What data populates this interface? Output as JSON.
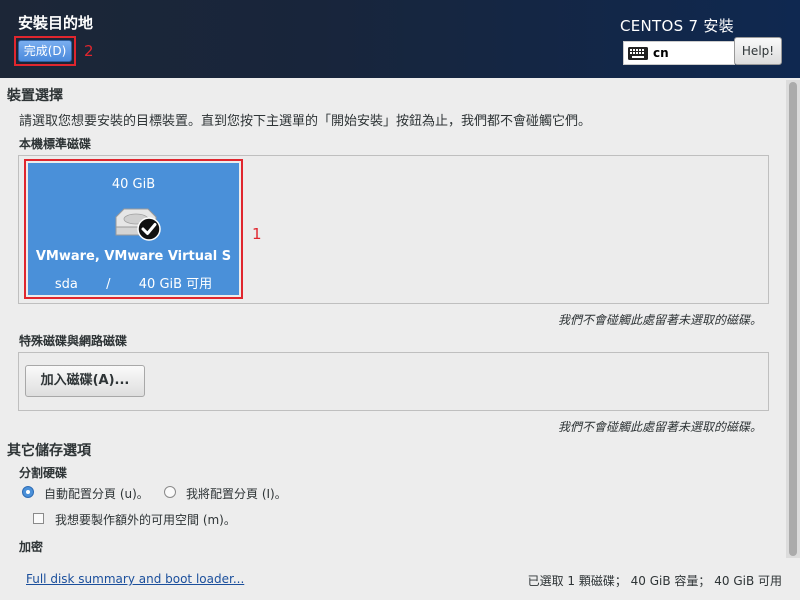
{
  "header": {
    "title": "安裝目的地",
    "done_label": "完成(D)",
    "annotation_done": "2",
    "product_title": "CENTOS 7 安裝",
    "keyboard_layout": "cn",
    "help_label": "Help!"
  },
  "device_selection": {
    "heading": "裝置選擇",
    "description": "請選取您想要安裝的目標裝置。直到您按下主選單的「開始安裝」按鈕為止，我們都不會碰觸它們。",
    "local_disks_heading": "本機標準磁碟",
    "disk": {
      "size": "40 GiB",
      "name": "VMware, VMware Virtual S",
      "device": "sda",
      "separator": "/",
      "free": "40 GiB 可用"
    },
    "annotation_disk": "1",
    "local_note": "我們不會碰觸此處留著未選取的磁碟。",
    "special_heading": "特殊磁碟與網路磁碟",
    "add_disk_label": "加入磁碟(A)...",
    "special_note": "我們不會碰觸此處留著未選取的磁碟。"
  },
  "other_storage": {
    "heading": "其它儲存選項",
    "partitioning_heading": "分割硬碟",
    "auto_partition_label": "自動配置分頁 (u)。",
    "manual_partition_label": "我將配置分頁 (I)。",
    "extra_space_label": "我想要製作額外的可用空間 (m)。",
    "encryption_heading": "加密"
  },
  "footer": {
    "summary_link": "Full disk summary and boot loader...",
    "status": "已選取 1 顆磁碟； 40 GiB 容量； 40 GiB 可用"
  },
  "icons": {
    "keyboard": "keyboard-icon",
    "disk": "hard-disk-icon",
    "check": "check-circle-icon"
  },
  "colors": {
    "accent": "#4a90d9",
    "annotation": "#e0262e",
    "header_bg": "#1c2637"
  }
}
